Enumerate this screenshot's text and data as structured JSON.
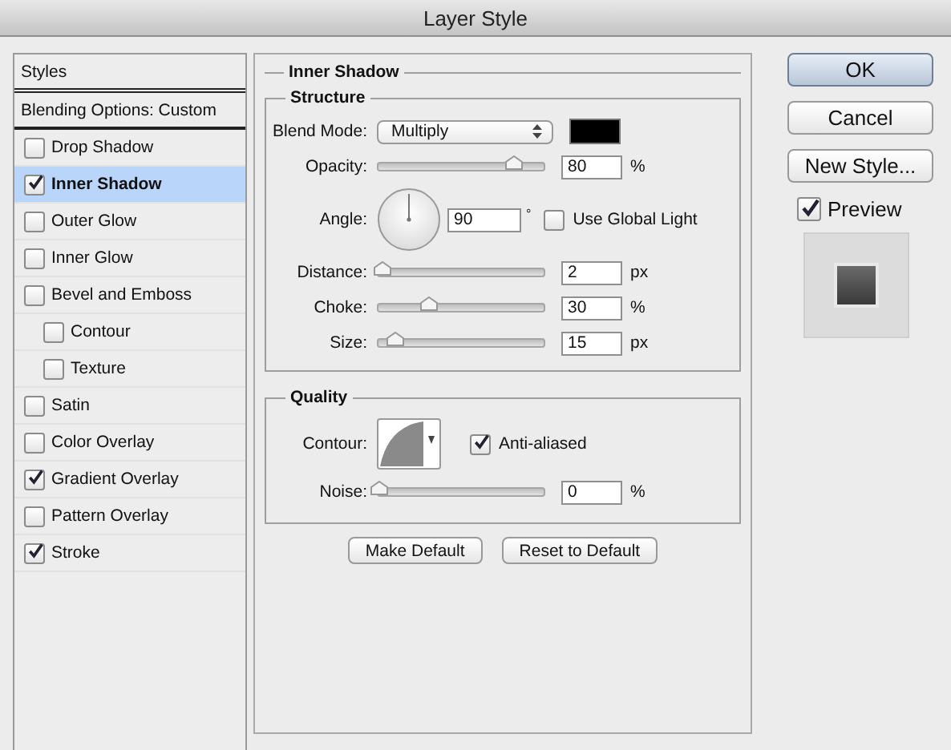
{
  "window": {
    "title": "Layer Style"
  },
  "sidebar": {
    "items": [
      {
        "label": "Styles",
        "kind": "header",
        "selected": false
      },
      {
        "label": "Blending Options: Custom",
        "kind": "header",
        "selected": false
      },
      {
        "label": "Drop Shadow",
        "kind": "effect",
        "checked": false,
        "selected": false
      },
      {
        "label": "Inner Shadow",
        "kind": "effect",
        "checked": true,
        "selected": true
      },
      {
        "label": "Outer Glow",
        "kind": "effect",
        "checked": false,
        "selected": false
      },
      {
        "label": "Inner Glow",
        "kind": "effect",
        "checked": false,
        "selected": false
      },
      {
        "label": "Bevel and Emboss",
        "kind": "effect",
        "checked": false,
        "selected": false
      },
      {
        "label": "Contour",
        "kind": "sub-effect",
        "checked": false,
        "selected": false
      },
      {
        "label": "Texture",
        "kind": "sub-effect",
        "checked": false,
        "selected": false
      },
      {
        "label": "Satin",
        "kind": "effect",
        "checked": false,
        "selected": false
      },
      {
        "label": "Color Overlay",
        "kind": "effect",
        "checked": false,
        "selected": false
      },
      {
        "label": "Gradient Overlay",
        "kind": "effect",
        "checked": true,
        "selected": false
      },
      {
        "label": "Pattern Overlay",
        "kind": "effect",
        "checked": false,
        "selected": false
      },
      {
        "label": "Stroke",
        "kind": "effect",
        "checked": true,
        "selected": false
      }
    ]
  },
  "panel": {
    "title": "Inner Shadow",
    "structure": {
      "title": "Structure",
      "rows": [
        {
          "kind": "blend",
          "label": "Blend Mode:",
          "value": "Multiply",
          "color": "#000000"
        },
        {
          "kind": "slider",
          "label": "Opacity:",
          "level": 0.82,
          "value": "80",
          "unit": "%"
        },
        {
          "kind": "angle",
          "label": "Angle:",
          "value": "90",
          "unit": "°",
          "option": {
            "label": "Use Global Light",
            "checked": false
          }
        },
        {
          "kind": "slider",
          "label": "Distance:",
          "level": 0.02,
          "value": "2",
          "unit": "px"
        },
        {
          "kind": "slider",
          "label": "Choke:",
          "level": 0.3,
          "value": "30",
          "unit": "%"
        },
        {
          "kind": "slider",
          "label": "Size:",
          "level": 0.1,
          "value": "15",
          "unit": "px"
        }
      ]
    },
    "quality": {
      "title": "Quality",
      "rows": [
        {
          "kind": "contour",
          "label": "Contour:",
          "option": {
            "label": "Anti-aliased",
            "checked": true
          }
        },
        {
          "kind": "slider",
          "label": "Noise:",
          "level": 0.0,
          "value": "0",
          "unit": "%"
        }
      ]
    },
    "buttons": [
      "Make Default",
      "Reset to Default"
    ]
  },
  "actions": [
    {
      "label": "OK",
      "default": true
    },
    {
      "label": "Cancel",
      "default": false
    },
    {
      "label": "New Style...",
      "default": false
    }
  ],
  "preview": {
    "label": "Preview",
    "checked": true
  }
}
